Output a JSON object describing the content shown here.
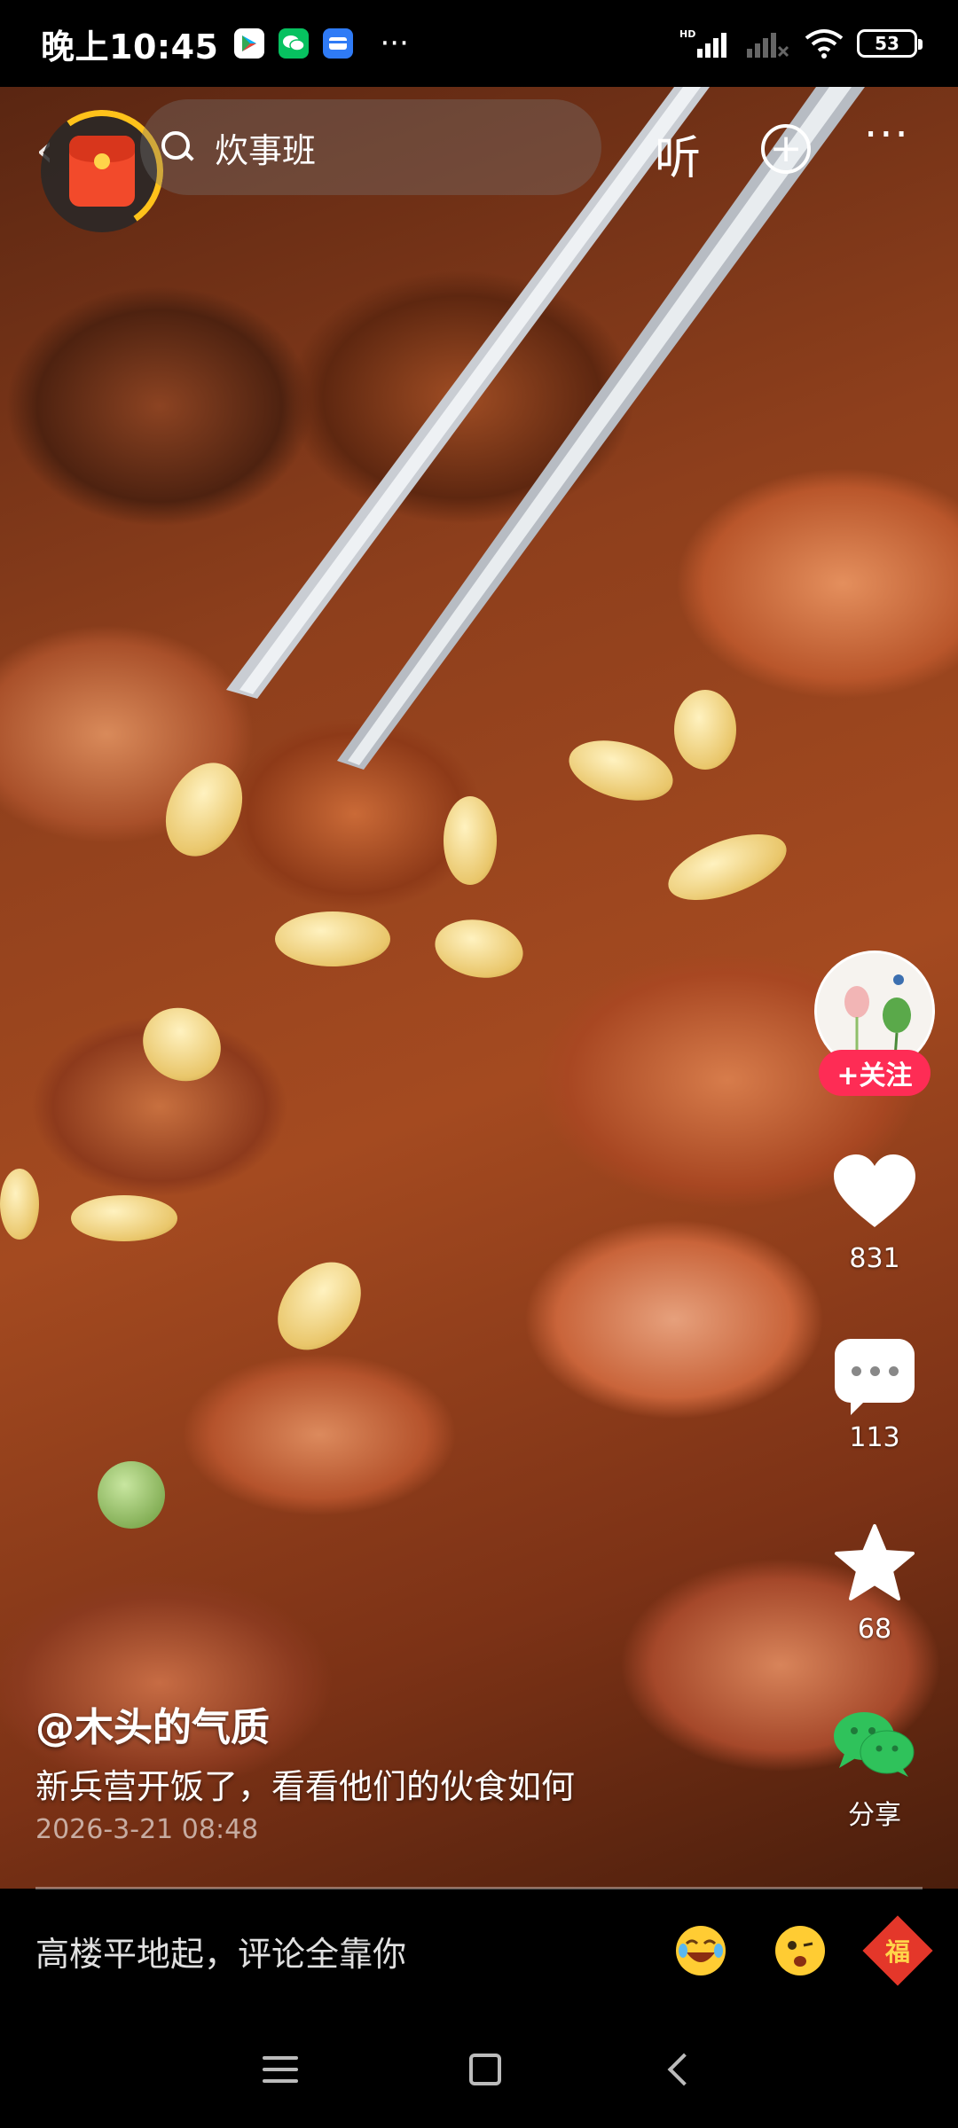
{
  "status_bar": {
    "time": "晚上10:45",
    "apps": [
      "play-store-icon",
      "wechat-icon",
      "card-app-icon"
    ],
    "more": "···",
    "network": "HD",
    "battery": "53"
  },
  "top_bar": {
    "search_text": "炊事班",
    "listen_label": "听",
    "plus_label": "+",
    "more_label": "···"
  },
  "right_rail": {
    "follow_label": "+关注",
    "likes": "831",
    "comments": "113",
    "favorites": "68",
    "share_label": "分享"
  },
  "caption": {
    "author": "@木头的气质",
    "description": "新兵营开饭了，看看他们的伙食如何",
    "date": "2026-3-21 08:48"
  },
  "comment_bar": {
    "placeholder": "高楼平地起，评论全靠你",
    "fu_label": "福"
  },
  "colors": {
    "follow_red": "#fe2c55",
    "wechat_green": "#07c160",
    "redpacket_ring": "#ffc21a"
  }
}
